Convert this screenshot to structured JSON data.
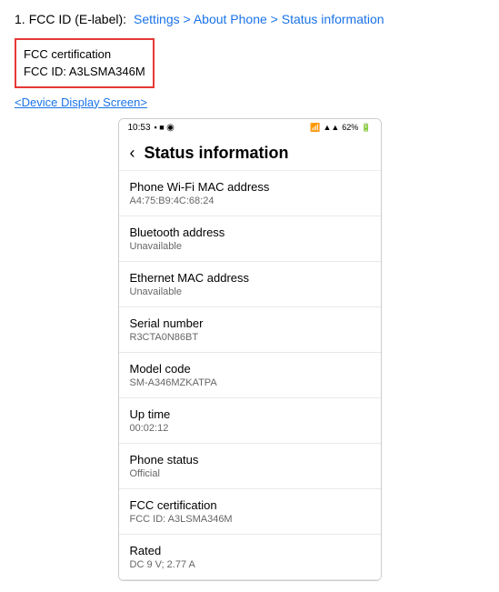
{
  "page": {
    "step_number": "1.",
    "step_label": "FCC ID (E-label):",
    "breadcrumb": "Settings > About Phone > Status information",
    "fcc_box": {
      "line1": "FCC certification",
      "line2": "FCC ID: A3LSMA346M"
    },
    "device_link": "<Device Display Screen>",
    "phone": {
      "status_bar": {
        "time": "10:53",
        "signal": "▪ ■ ◉",
        "right": "📶 ✦ 62% 🔋"
      },
      "header_title": "Status information",
      "back_label": "‹",
      "rows": [
        {
          "label": "Phone Wi-Fi MAC address",
          "value": "A4:75:B9:4C:68:24"
        },
        {
          "label": "Bluetooth address",
          "value": "Unavailable"
        },
        {
          "label": "Ethernet MAC address",
          "value": "Unavailable"
        },
        {
          "label": "Serial number",
          "value": "R3CTA0N86BT"
        },
        {
          "label": "Model code",
          "value": "SM-A346MZKATPA"
        },
        {
          "label": "Up time",
          "value": "00:02:12"
        },
        {
          "label": "Phone status",
          "value": "Official"
        },
        {
          "label": "FCC certification",
          "value": "FCC ID: A3LSMA346M"
        },
        {
          "label": "Rated",
          "value": "DC 9 V; 2.77 A"
        }
      ]
    }
  }
}
